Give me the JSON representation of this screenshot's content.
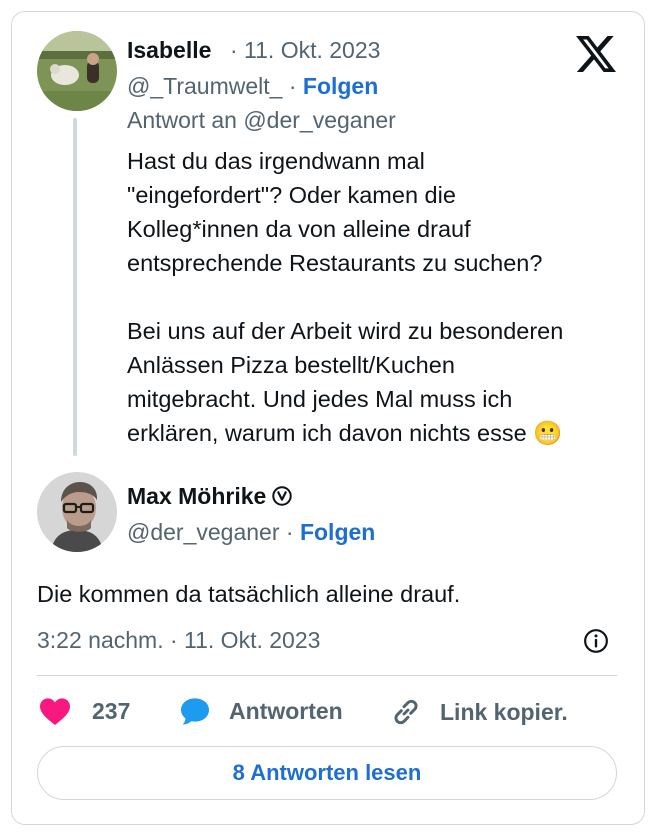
{
  "reply_tweet": {
    "author_name": "Isabelle",
    "date": "· 11. Okt. 2023",
    "handle": "@_Traumwelt_",
    "follow_sep": " · ",
    "follow_label": "Folgen",
    "reply_to": "Antwort an @der_veganer",
    "lines": [
      "Hast du das irgendwann mal",
      "\"eingefordert\"? Oder kamen die",
      "Kolleg*innen da von alleine drauf",
      "entsprechende Restaurants zu suchen?",
      "",
      "Bei uns auf der Arbeit wird zu besonderen",
      "Anlässen Pizza bestellt/Kuchen",
      "mitgebracht. Und jedes Mal muss ich",
      "erklären, warum ich davon nichts esse 😬"
    ]
  },
  "main_tweet": {
    "author_name": "Max Möhrike",
    "handle": "@der_veganer",
    "follow_sep": " · ",
    "follow_label": "Folgen",
    "text": "Die kommen da tatsächlich alleine drauf.",
    "timestamp": "3:22 nachm. · 11. Okt. 2023"
  },
  "actions": {
    "like_count": "237",
    "reply_label": "Antworten",
    "copy_link_label": "Link kopier."
  },
  "read_replies_label": "8 Antworten lesen",
  "colors": {
    "like": "#f91880",
    "reply_bubble": "#1d9bf0",
    "link": "#1d6fd1",
    "muted": "#536471",
    "border": "#cfd9de"
  },
  "icons": [
    "x-logo-icon",
    "verified-icon",
    "info-icon",
    "heart-icon",
    "speech-bubble-icon",
    "link-icon"
  ]
}
